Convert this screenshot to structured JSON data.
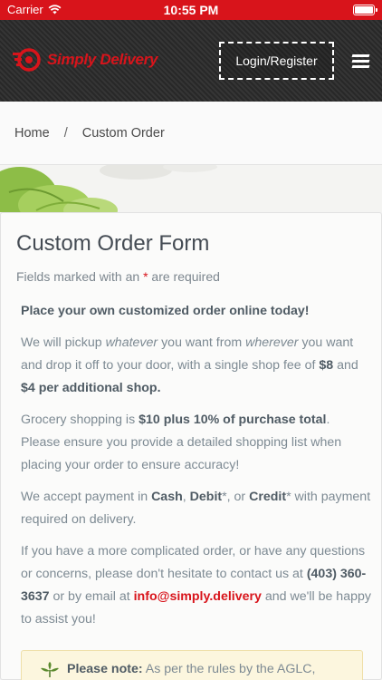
{
  "status_bar": {
    "carrier": "Carrier",
    "time": "10:55 PM"
  },
  "header": {
    "brand": "Simply Delivery",
    "login_label": "Login/Register"
  },
  "breadcrumb": {
    "home": "Home",
    "separator": "/",
    "current": "Custom Order"
  },
  "form": {
    "title": "Custom Order Form",
    "required_prefix": "Fields marked with an ",
    "required_star": "*",
    "required_suffix": " are required",
    "lead": "Place your own customized order online today!",
    "p1": {
      "a": "We will pickup ",
      "b": "whatever",
      "c": " you want from ",
      "d": "wherever",
      "e": " you want and drop it off to your door, with a single shop fee of ",
      "f": "$8",
      "g": " and ",
      "h": "$4 per additional shop."
    },
    "p2": {
      "a": "Grocery shopping is ",
      "b": "$10 plus 10% of purchase total",
      "c": ". Please ensure you provide a detailed shopping list when placing your order to ensure accuracy!"
    },
    "p3": {
      "a": "We accept payment in ",
      "b": "Cash",
      "c": ", ",
      "d": "Debit",
      "e": "*, or ",
      "f": "Credit",
      "g": "* with payment required on delivery."
    },
    "p4": {
      "a": "If you have a more complicated order, or have any questions or concerns, please don't hesitate to contact us at ",
      "phone": "(403) 360-3637",
      "b": " or by email at ",
      "email": "info@simply.delivery",
      "c": " and we'll be happy to assist you!"
    },
    "note": {
      "label": "Please note:",
      "text": " As per the rules by the AGLC,"
    }
  },
  "colors": {
    "brand_red": "#d8141b",
    "header_bg": "#2a2a2a",
    "note_bg": "#fcf6de"
  }
}
